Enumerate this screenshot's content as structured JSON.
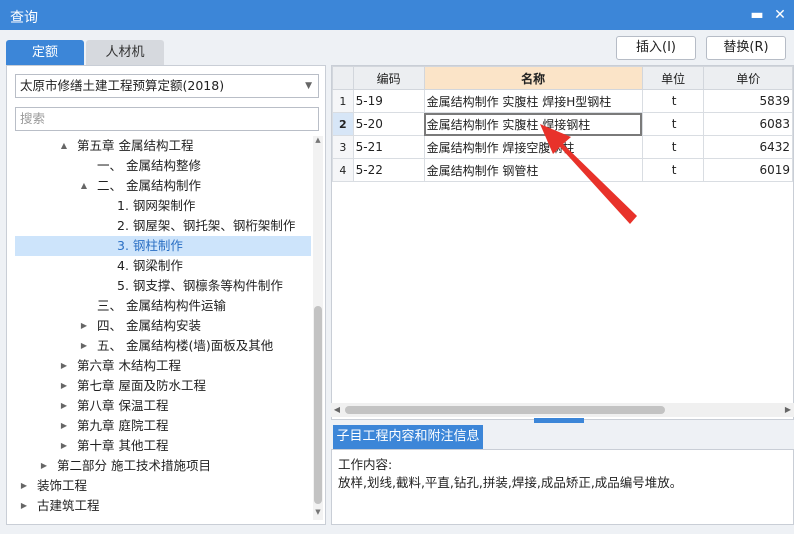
{
  "window": {
    "title": "查询"
  },
  "tabs": [
    {
      "label": "定额"
    },
    {
      "label": "人材机"
    }
  ],
  "actions": {
    "insert_label": "插入(I)",
    "replace_label": "替换(R)"
  },
  "left": {
    "quota_library": "太原市修缮土建工程预算定额(2018)",
    "search_placeholder": "搜索",
    "tree": [
      {
        "label": "第五章 金属结构工程",
        "expand": "▲"
      },
      {
        "label": "一、 金属结构整修",
        "expand": ""
      },
      {
        "label": "二、 金属结构制作",
        "expand": "▲"
      },
      {
        "label": "1. 钢网架制作",
        "expand": ""
      },
      {
        "label": "2. 钢屋架、钢托架、钢桁架制作",
        "expand": ""
      },
      {
        "label": "3. 钢柱制作",
        "expand": ""
      },
      {
        "label": "4. 钢梁制作",
        "expand": ""
      },
      {
        "label": "5. 钢支撑、钢檩条等构件制作",
        "expand": ""
      },
      {
        "label": "三、 金属结构构件运输",
        "expand": ""
      },
      {
        "label": "四、 金属结构安装",
        "expand": "▶"
      },
      {
        "label": "五、 金属结构楼(墙)面板及其他",
        "expand": "▶"
      },
      {
        "label": "第六章 木结构工程",
        "expand": "▶"
      },
      {
        "label": "第七章 屋面及防水工程",
        "expand": "▶"
      },
      {
        "label": "第八章 保温工程",
        "expand": "▶"
      },
      {
        "label": "第九章 庭院工程",
        "expand": "▶"
      },
      {
        "label": "第十章 其他工程",
        "expand": "▶"
      },
      {
        "label": "第二部分 施工技术措施项目",
        "expand": "▶"
      },
      {
        "label": "装饰工程",
        "expand": "▶"
      },
      {
        "label": "古建筑工程",
        "expand": "▶"
      }
    ]
  },
  "grid": {
    "columns": [
      "编码",
      "名称",
      "单位",
      "单价"
    ],
    "rows": [
      {
        "num": "1",
        "code": "5-19",
        "name": "金属结构制作 实腹柱 焊接H型钢柱",
        "unit": "t",
        "price": "5839"
      },
      {
        "num": "2",
        "code": "5-20",
        "name": "金属结构制作 实腹柱 焊接钢柱",
        "unit": "t",
        "price": "6083"
      },
      {
        "num": "3",
        "code": "5-21",
        "name": "金属结构制作 焊接空腹钢柱",
        "unit": "t",
        "price": "6432"
      },
      {
        "num": "4",
        "code": "5-22",
        "name": "金属结构制作 钢管柱",
        "unit": "t",
        "price": "6019"
      }
    ]
  },
  "info": {
    "tab_label": "子目工程内容和附注信息",
    "heading": "工作内容:",
    "content": "放样,划线,截料,平直,钻孔,拼装,焊接,成品矫正,成品编号堆放。"
  },
  "colors": {
    "accent": "#3c86d8",
    "annotation_arrow": "#e8322a",
    "name_header": "#fbe4c8"
  }
}
